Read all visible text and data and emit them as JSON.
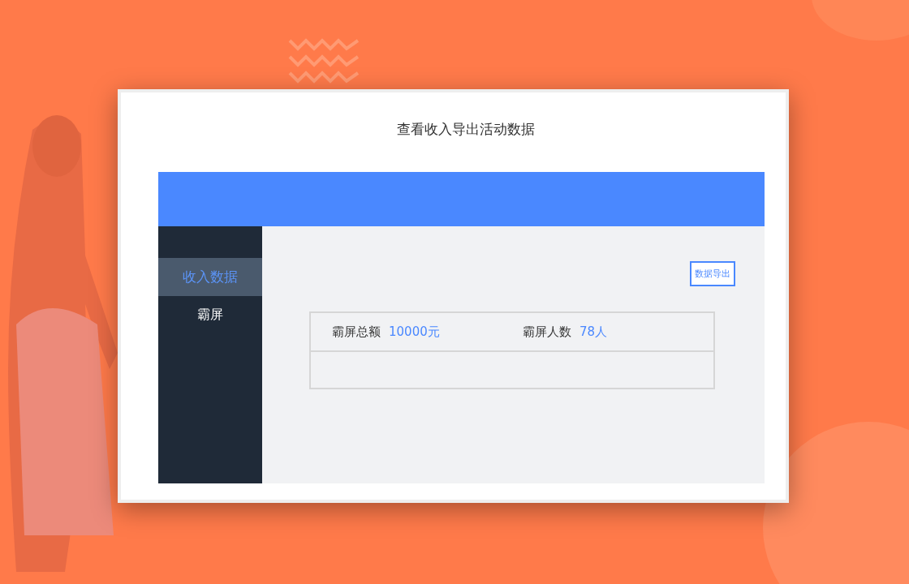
{
  "title": "查看收入导出活动数据",
  "sidebar": {
    "items": [
      {
        "label": "收入数据",
        "selected": true
      },
      {
        "label": "霸屏",
        "selected": false
      }
    ]
  },
  "export_button": "数据导出",
  "stats": [
    {
      "label": "霸屏总额",
      "value": "10000元"
    },
    {
      "label": "霸屏人数",
      "value": "78人"
    }
  ]
}
